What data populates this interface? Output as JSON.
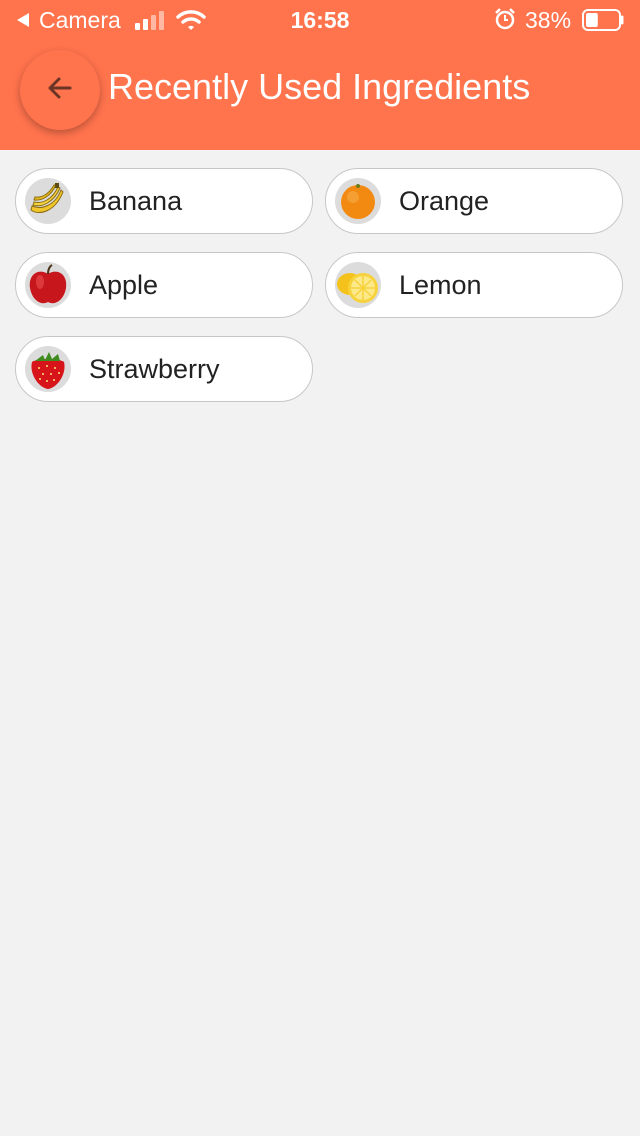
{
  "status_bar": {
    "back_app": "Camera",
    "time": "16:58",
    "battery": "38%",
    "battery_level": 0.38
  },
  "header": {
    "title": "Recently Used Ingredients",
    "back_icon": "arrow-left-icon",
    "color": "#ff734d"
  },
  "ingredients": [
    {
      "label": "Banana",
      "icon": "banana-icon"
    },
    {
      "label": "Orange",
      "icon": "orange-icon"
    },
    {
      "label": "Apple",
      "icon": "apple-icon"
    },
    {
      "label": "Lemon",
      "icon": "lemon-icon"
    },
    {
      "label": "Strawberry",
      "icon": "strawberry-icon"
    }
  ]
}
